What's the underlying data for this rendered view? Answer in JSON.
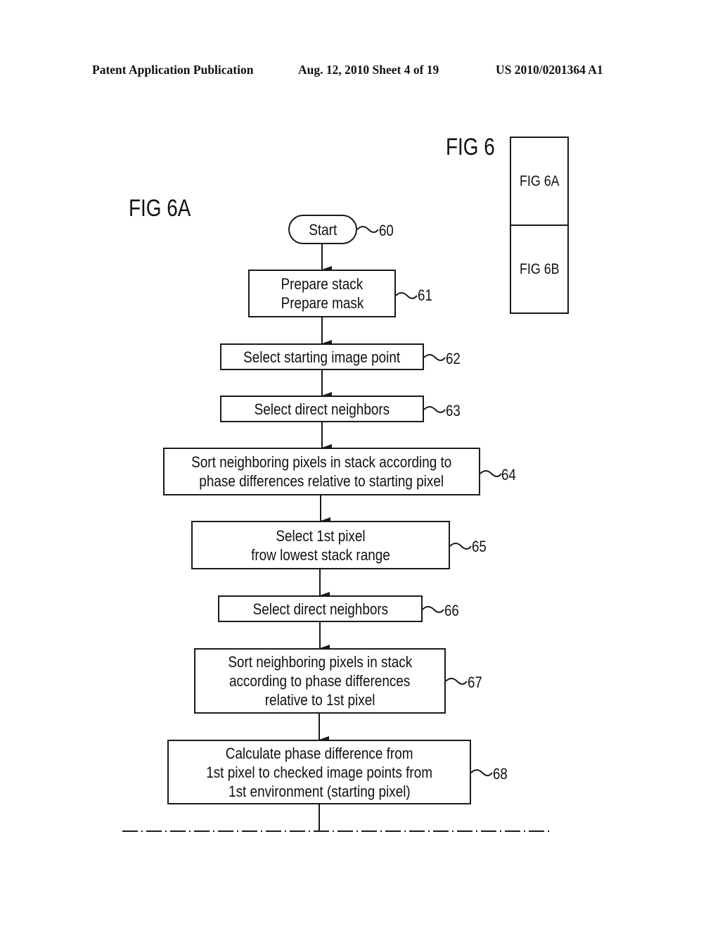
{
  "header": {
    "publication": "Patent Application Publication",
    "date_sheet": "Aug. 12, 2010  Sheet 4 of 19",
    "patent_number": "US 2010/0201364 A1"
  },
  "figure_key": {
    "title": "FIG 6",
    "parts": [
      "FIG 6A",
      "FIG 6B"
    ]
  },
  "figure": {
    "title": "FIG 6A",
    "nodes": [
      {
        "id": "60",
        "shape": "terminal",
        "lines": [
          "Start"
        ]
      },
      {
        "id": "61",
        "shape": "process",
        "lines": [
          "Prepare stack",
          "Prepare mask"
        ]
      },
      {
        "id": "62",
        "shape": "process",
        "lines": [
          "Select starting image point"
        ]
      },
      {
        "id": "63",
        "shape": "process",
        "lines": [
          "Select direct neighbors"
        ]
      },
      {
        "id": "64",
        "shape": "process",
        "lines": [
          "Sort neighboring pixels in stack according to",
          "phase differences relative to starting pixel"
        ]
      },
      {
        "id": "65",
        "shape": "process",
        "lines": [
          "Select 1st pixel",
          "frow lowest stack range"
        ]
      },
      {
        "id": "66",
        "shape": "process",
        "lines": [
          "Select direct neighbors"
        ]
      },
      {
        "id": "67",
        "shape": "process",
        "lines": [
          "Sort neighboring pixels in stack",
          "according to phase differences",
          "relative to 1st pixel"
        ]
      },
      {
        "id": "68",
        "shape": "process",
        "lines": [
          "Calculate phase difference from",
          "1st pixel to checked image points from",
          "1st environment (starting pixel)"
        ]
      }
    ],
    "edges": [
      [
        "60",
        "61"
      ],
      [
        "61",
        "62"
      ],
      [
        "62",
        "63"
      ],
      [
        "63",
        "64"
      ],
      [
        "64",
        "65"
      ],
      [
        "65",
        "66"
      ],
      [
        "66",
        "67"
      ],
      [
        "67",
        "68"
      ]
    ],
    "continuation": "dash-dot break line (continues in FIG 6B)"
  }
}
